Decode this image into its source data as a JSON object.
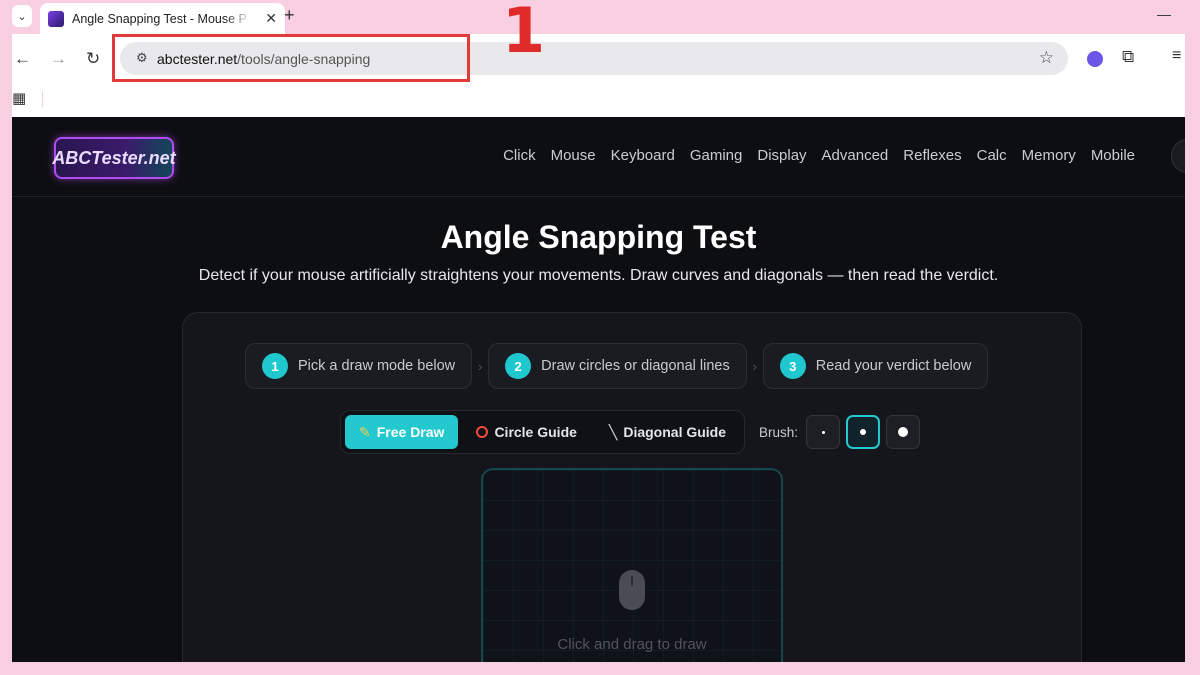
{
  "browser": {
    "tab_title": "Angle Snapping Test - Mouse P",
    "tab_close": "✕",
    "new_tab": "+",
    "minimize": "—",
    "step_marker": "1",
    "url_host": "abctester.net",
    "url_path": "/tools/angle-snapping"
  },
  "site": {
    "logo_text": "ABCTester.net",
    "nav": [
      "Click",
      "Mouse",
      "Keyboard",
      "Gaming",
      "Display",
      "Advanced",
      "Reflexes",
      "Calc",
      "Memory",
      "Mobile"
    ]
  },
  "main": {
    "title": "Angle Snapping Test",
    "subtitle": "Detect if your mouse artificially straightens your movements. Draw curves and diagonals — then read the verdict.",
    "steps": [
      {
        "num": "1",
        "label": "Pick a draw mode below"
      },
      {
        "num": "2",
        "label": "Draw circles or diagonal lines"
      },
      {
        "num": "3",
        "label": "Read your verdict below"
      }
    ],
    "step_separator": "›",
    "modes": {
      "free_draw": "Free Draw",
      "circle_guide": "Circle Guide",
      "diagonal_guide": "Diagonal Guide",
      "active": "free_draw"
    },
    "brush_label": "Brush:",
    "brush_selected": "medium",
    "canvas_hint": "Click and drag to draw"
  },
  "colors": {
    "accent": "#23c9cf",
    "highlight": "#e23a3a",
    "page_bg": "#0d0e12"
  }
}
